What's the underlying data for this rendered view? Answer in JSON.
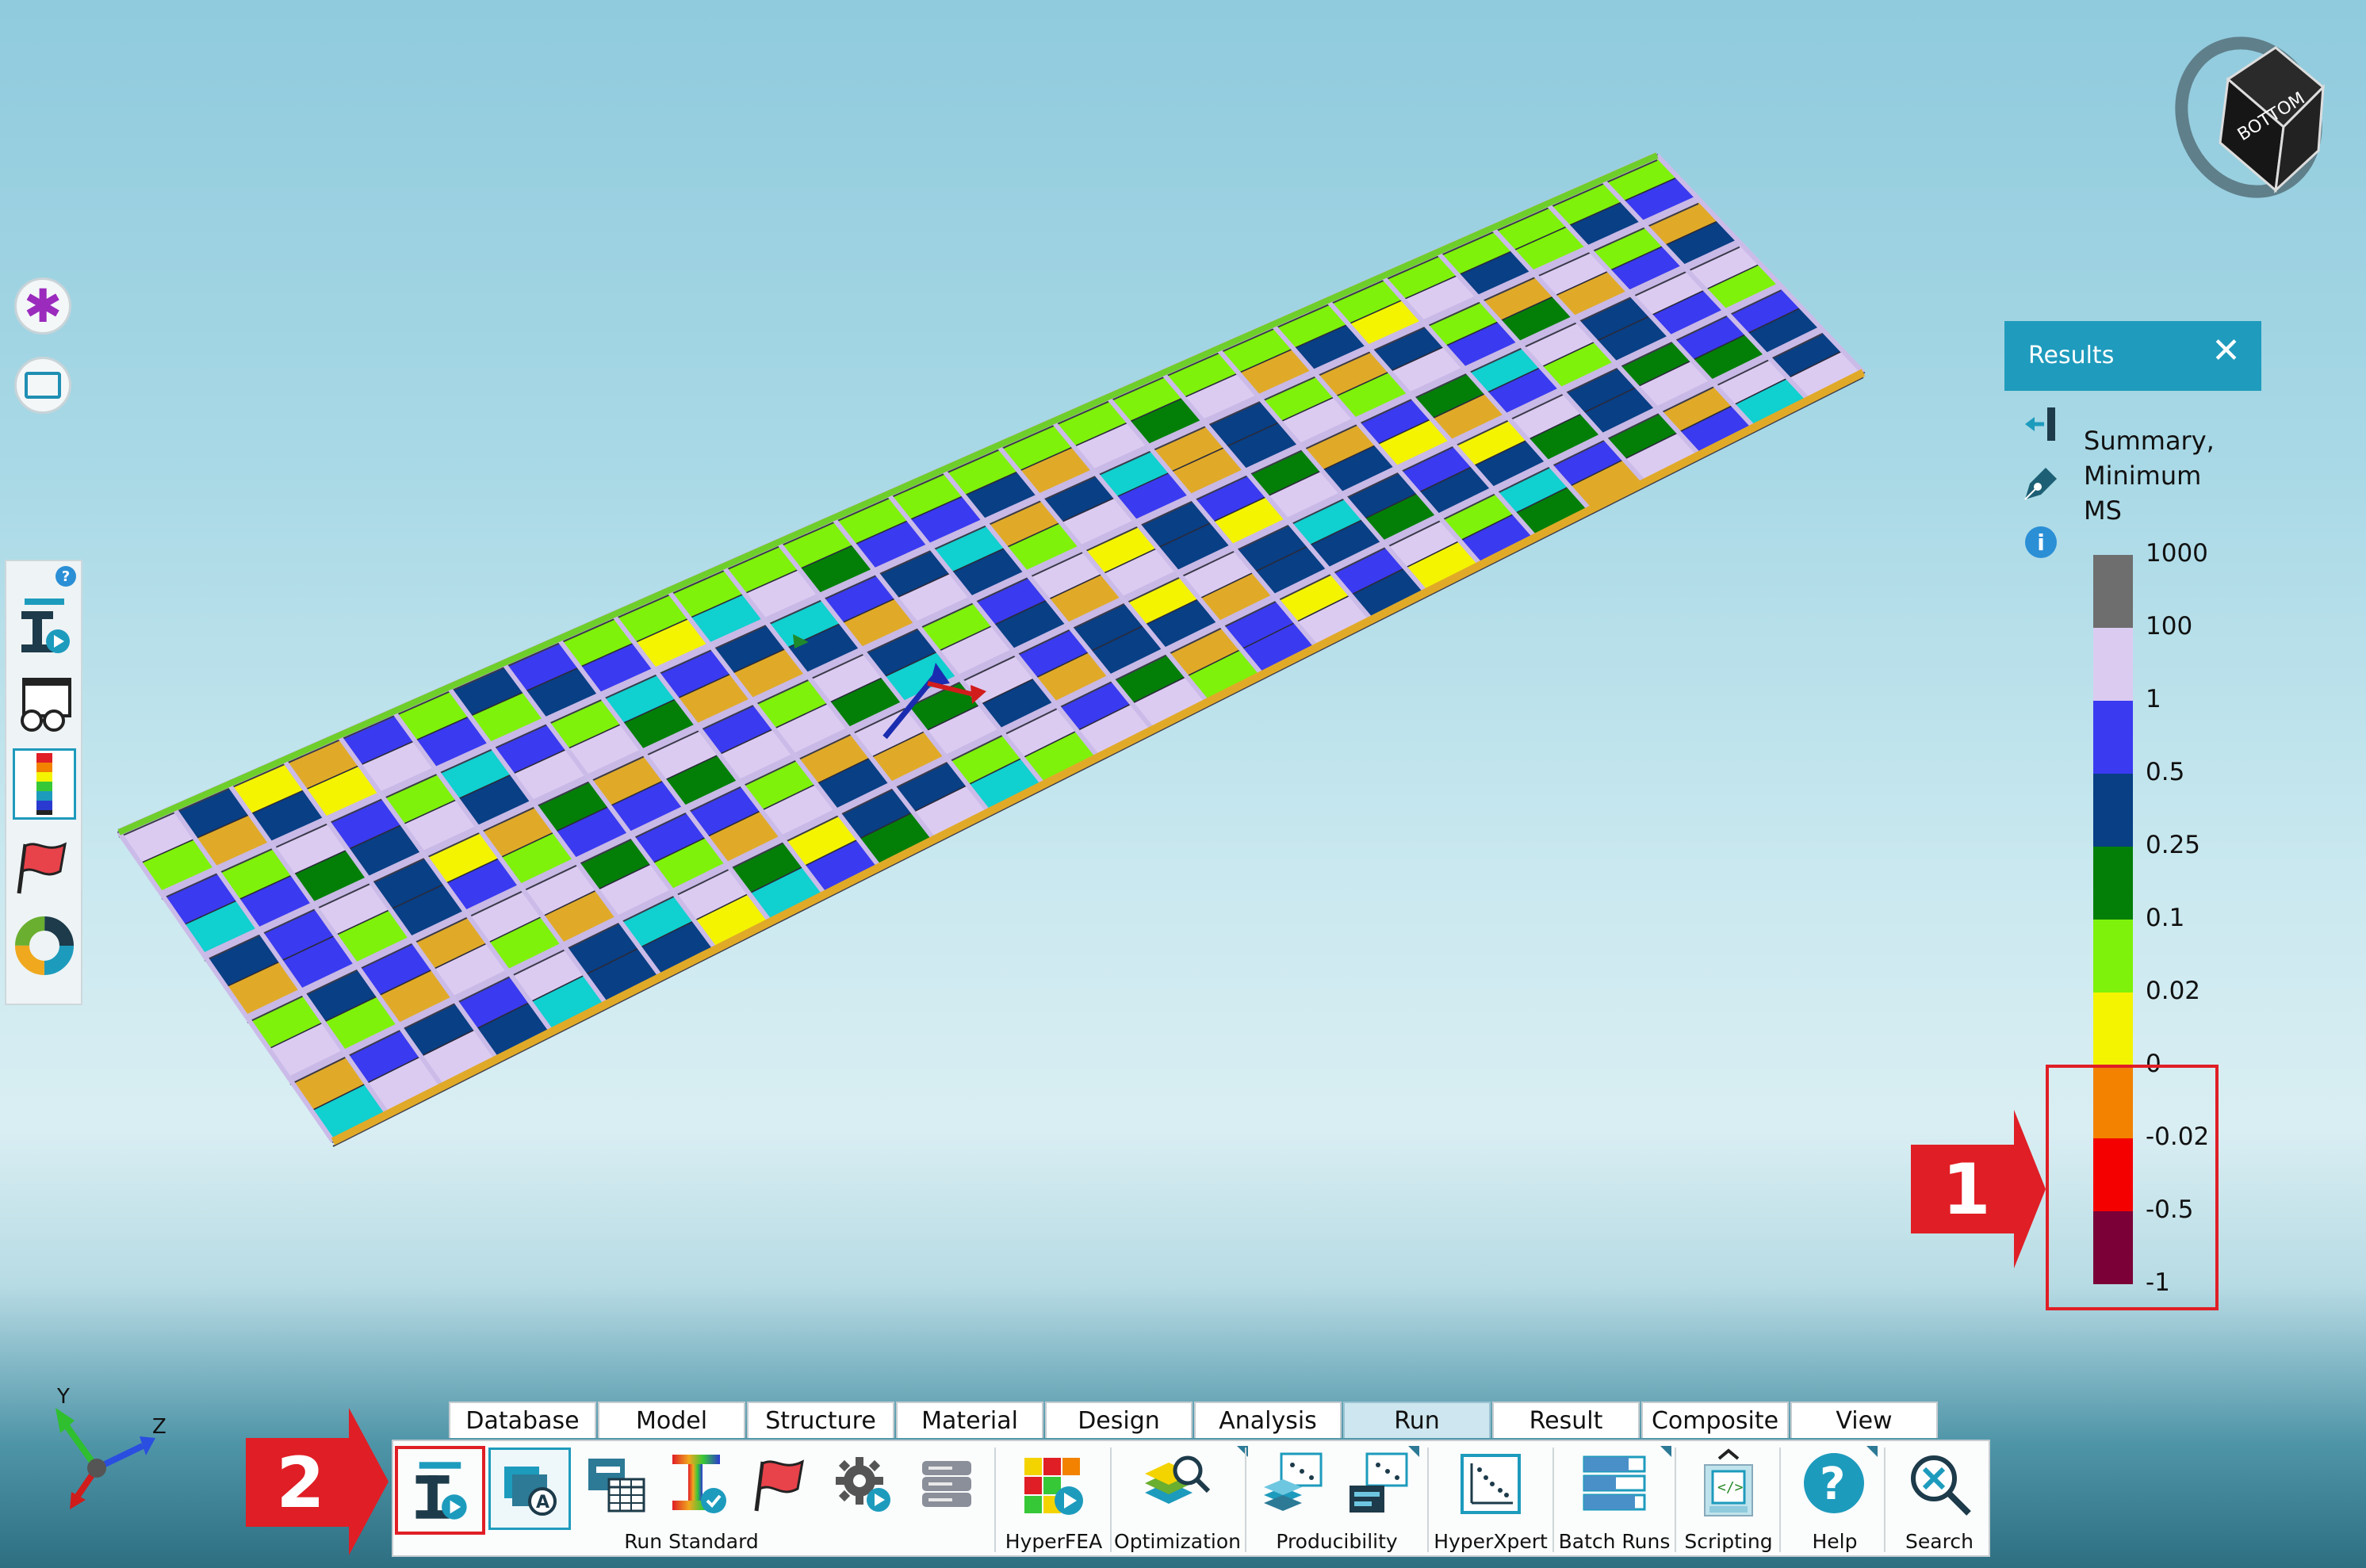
{
  "results_panel": {
    "title": "Results",
    "close_glyph": "✕",
    "description": [
      "Summary,",
      "Minimum",
      "MS"
    ],
    "icons": [
      "collapse-panel-icon",
      "pen-icon",
      "info-icon"
    ]
  },
  "legend": {
    "labels": [
      "1000",
      "100",
      "1",
      "0.5",
      "0.25",
      "0.1",
      "0.02",
      "0",
      "-0.02",
      "-0.5",
      "-1"
    ],
    "colors": [
      "#6e6e6e",
      "#dccbf1",
      "#3a3af0",
      "#083f85",
      "#037f08",
      "#7ef20a",
      "#f4f400",
      "#f28200",
      "#f50000",
      "#7a0037"
    ]
  },
  "callouts": {
    "one": "1",
    "two": "2"
  },
  "view_cube": {
    "face_label": "BOTTOM"
  },
  "triad": {
    "y": "Y",
    "z": "Z"
  },
  "ribbon": {
    "tabs": [
      "Database",
      "Model",
      "Structure",
      "Material",
      "Design",
      "Analysis",
      "Run",
      "Result",
      "Composite",
      "View"
    ],
    "active_tab": "Run",
    "groups": {
      "run_standard": "Run Standard",
      "hyperfea": "HyperFEA",
      "optimization": "Optimization",
      "producibility": "Producibility",
      "hyperxpert": "HyperXpert",
      "batch_runs": "Batch Runs",
      "scripting": "Scripting",
      "help": "Help",
      "search": "Search"
    }
  },
  "left_panel": {
    "help_glyph": "?"
  }
}
